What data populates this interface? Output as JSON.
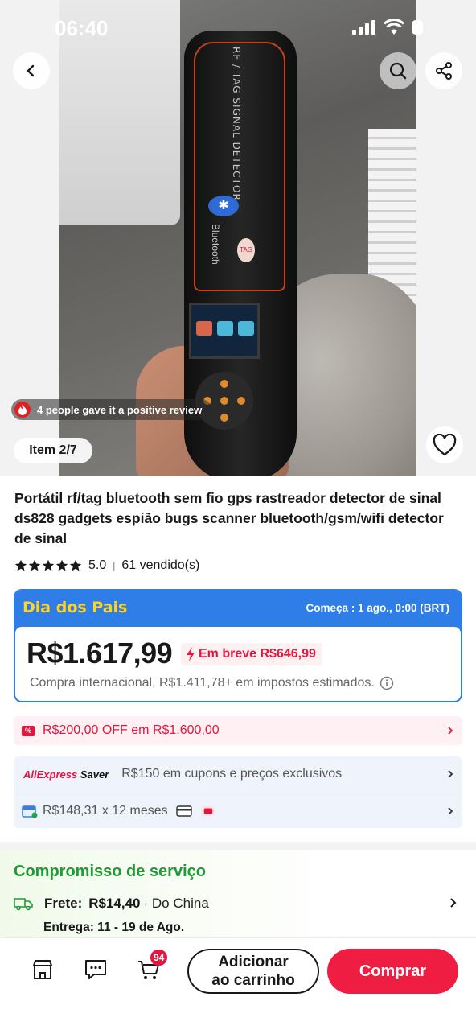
{
  "status_bar": {
    "time": "06:40"
  },
  "gallery": {
    "review_text": "4 people gave it a positive review",
    "item_counter": "Item 2/7",
    "device_text": "RF / TAG SIGNAL DETECTOR",
    "device_bluetooth": "Bluetooth",
    "device_tag": "TAG"
  },
  "product": {
    "title": "Portátil rf/tag bluetooth sem fio gps rastreador detector de sinal ds828 gadgets espião bugs scanner bluetooth/gsm/wifi detector de sinal",
    "rating": "5.0",
    "sold": "61 vendido(s)",
    "stars": 5
  },
  "promo": {
    "name": "Dia dos Pais",
    "starts": "Começa : 1 ago., 0:00 (BRT)",
    "price": "R$1.617,99",
    "soon_price": "Em breve R$646,99",
    "taxes": "Compra internacional, R$1.411,78+ em impostos estimados."
  },
  "coupon": {
    "label": "R$200,00 OFF em R$1.600,00",
    "icon": "%"
  },
  "saver": {
    "logo_prefix": "AliExpress",
    "logo_suffix": "Saver",
    "text": "R$150 em cupons e preços exclusivos",
    "installments": "R$148,31 x 12 meses"
  },
  "service": {
    "title": "Compromisso de serviço",
    "shipping_label": "Frete:",
    "shipping_value": "R$14,40",
    "shipping_from": "· Do China",
    "delivery": "Entrega: 11 - 19 de Ago."
  },
  "bottom_bar": {
    "cart_count": "94",
    "add_to_cart_line1": "Adicionar",
    "add_to_cart_line2": "ao carrinho",
    "buy": "Comprar"
  },
  "colors": {
    "accent_red": "#ee1d41",
    "promo_blue": "#2f7de7",
    "promo_yellow": "#ffd321",
    "service_green": "#1f9b36"
  }
}
